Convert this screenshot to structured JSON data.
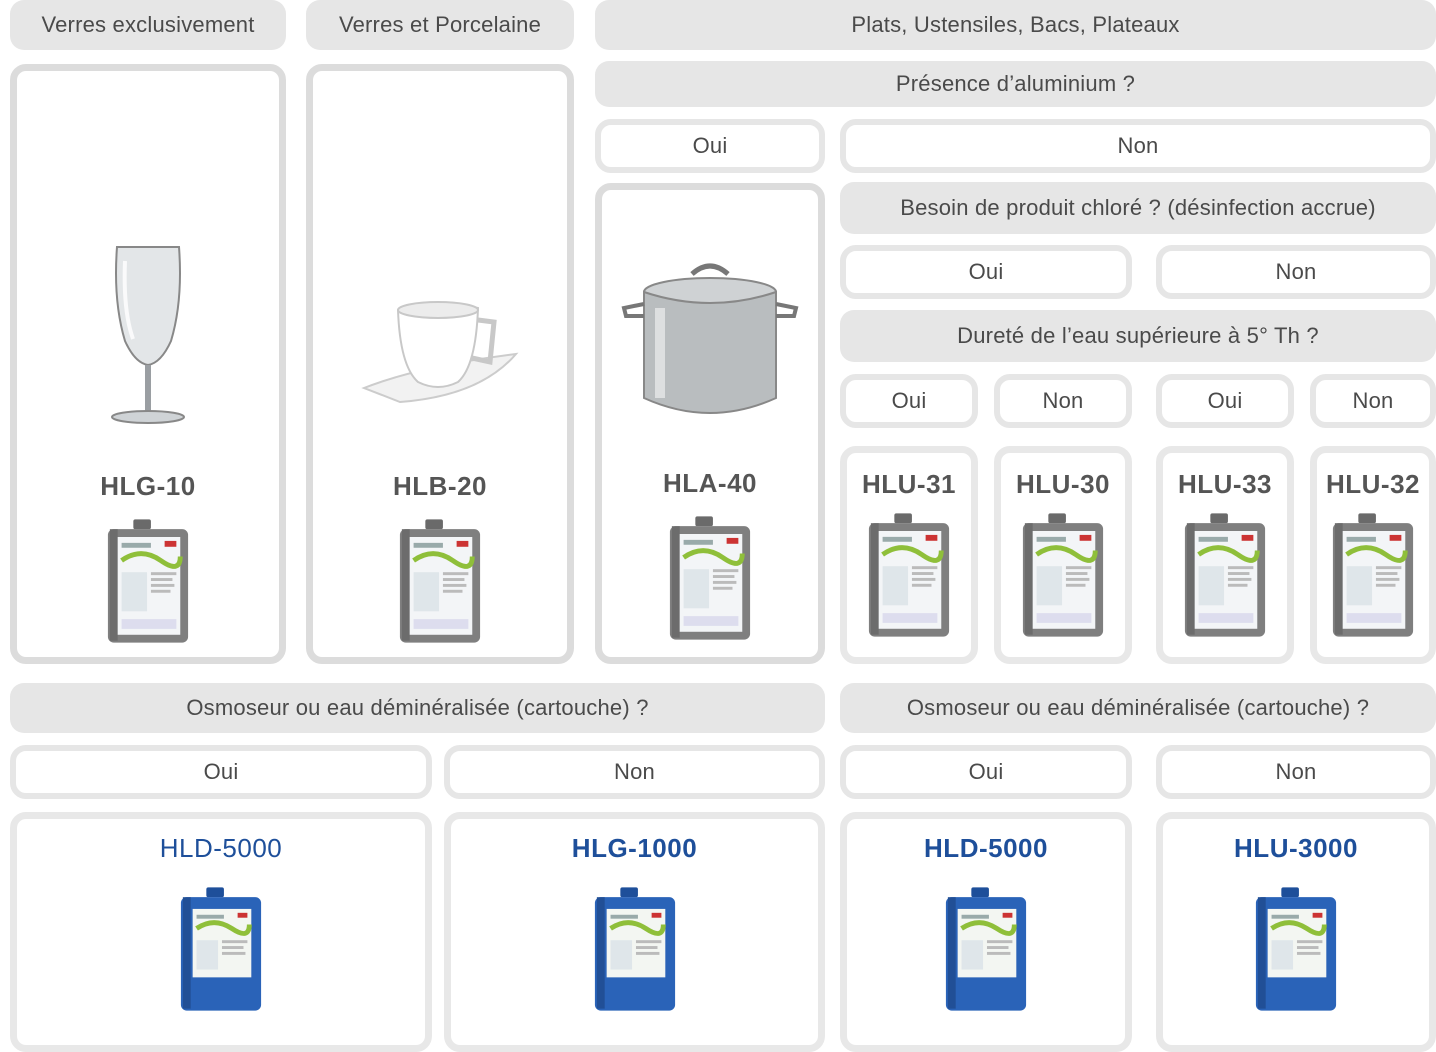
{
  "header": {
    "glass_only": "Verres exclusivement",
    "glass_porcelain": "Verres et Porcelaine",
    "dishes": "Plats, Ustensiles, Bacs, Plateaux"
  },
  "questions": {
    "aluminium": "Présence d’aluminium ?",
    "chlorine": "Besoin de produit chloré ? (désinfection accrue)",
    "hardness": "Dureté de l’eau supérieure à 5° Th ?",
    "osmosis": "Osmoseur ou eau déminéralisée (cartouche) ?"
  },
  "answers": {
    "yes": "Oui",
    "no": "Non"
  },
  "products": {
    "hlg10": "HLG-10",
    "hlb20": "HLB-20",
    "hla40": "HLA-40",
    "hlu31": "HLU-31",
    "hlu30": "HLU-30",
    "hlu33": "HLU-33",
    "hlu32": "HLU-32",
    "hld5000_a": "HLD-5000",
    "hlg1000": "HLG-1000",
    "hld5000_b": "HLD-5000",
    "hlu3000": "HLU-3000"
  },
  "colors": {
    "grey_pill": "#e6e6e6",
    "panel_border": "#dcdcdc",
    "brand_blue": "#1e4f9a",
    "can_grey": "#7a7a7a",
    "can_blue": "#2a63b8"
  },
  "icons": [
    "wine-glass-icon",
    "coffee-cup-icon",
    "stock-pot-icon",
    "canister-icon"
  ]
}
